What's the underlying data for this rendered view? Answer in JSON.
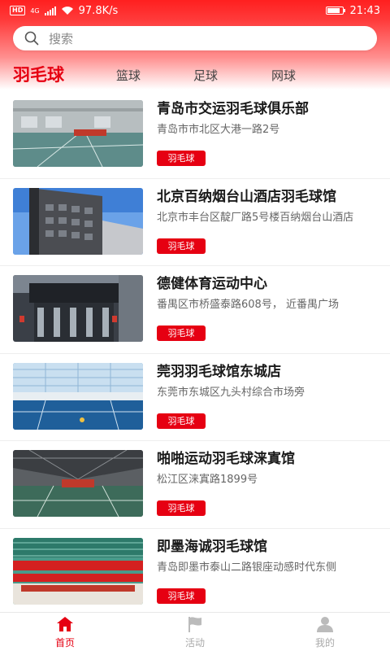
{
  "status": {
    "speed": "97.8K/s",
    "time": "21:43",
    "hd": "HD",
    "net": "4G",
    "battery_level": 0.85
  },
  "search": {
    "placeholder": "搜索",
    "icon": "search-icon"
  },
  "tabs": [
    {
      "label": "羽毛球",
      "active": true
    },
    {
      "label": "篮球",
      "active": false
    },
    {
      "label": "足球",
      "active": false
    },
    {
      "label": "网球",
      "active": false
    }
  ],
  "venues": [
    {
      "title": "青岛市交运羽毛球俱乐部",
      "address": "青岛市市北区大港一路2号",
      "tag": "羽毛球"
    },
    {
      "title": "北京百纳烟台山酒店羽毛球馆",
      "address": "北京市丰台区靛厂路5号楼百纳烟台山酒店",
      "tag": "羽毛球"
    },
    {
      "title": "德健体育运动中心",
      "address": "番禺区市桥盛泰路608号， 近番禺广场",
      "tag": "羽毛球"
    },
    {
      "title": "莞羽羽毛球馆东城店",
      "address": "东莞市东城区九头村综合市场旁",
      "tag": "羽毛球"
    },
    {
      "title": "啪啪运动羽毛球涞寘馆",
      "address": "松江区涞寘路1899号",
      "tag": "羽毛球"
    },
    {
      "title": "即墨海诚羽毛球馆",
      "address": "青岛即墨市泰山二路银座动感时代东侧",
      "tag": "羽毛球"
    }
  ],
  "nav": [
    {
      "label": "首页",
      "icon": "home-icon",
      "active": true
    },
    {
      "label": "活动",
      "icon": "flag-icon",
      "active": false
    },
    {
      "label": "我的",
      "icon": "user-icon",
      "active": false
    }
  ],
  "colors": {
    "brand": "#e60012",
    "header": "#ff2a2a"
  }
}
